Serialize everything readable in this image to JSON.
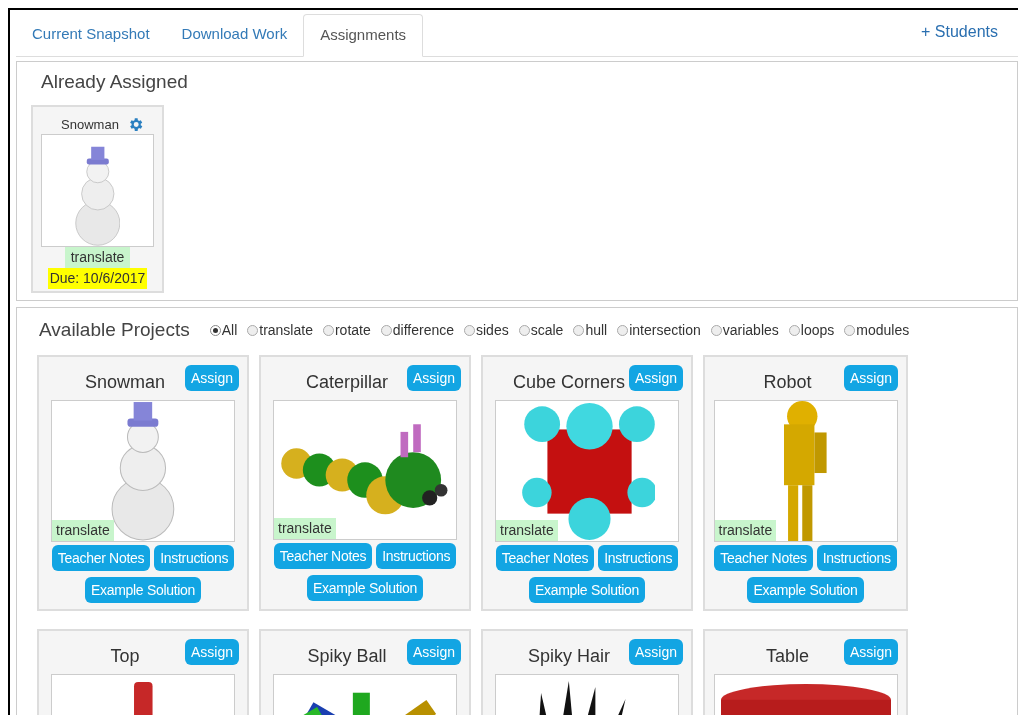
{
  "tabs": [
    {
      "label": "Current Snapshot",
      "selected": false
    },
    {
      "label": "Download Work",
      "selected": false
    },
    {
      "label": "Assignments",
      "selected": true
    }
  ],
  "students_link": "+ Students",
  "assigned": {
    "heading": "Already Assigned",
    "items": [
      {
        "title": "Snowman",
        "kind": "snowman",
        "tag": "translate",
        "due": "Due: 10/6/2017"
      }
    ]
  },
  "available": {
    "heading": "Available Projects",
    "filters": [
      {
        "label": "All",
        "selected": true
      },
      {
        "label": "translate",
        "selected": false
      },
      {
        "label": "rotate",
        "selected": false
      },
      {
        "label": "difference",
        "selected": false
      },
      {
        "label": "sides",
        "selected": false
      },
      {
        "label": "scale",
        "selected": false
      },
      {
        "label": "hull",
        "selected": false
      },
      {
        "label": "intersection",
        "selected": false
      },
      {
        "label": "variables",
        "selected": false
      },
      {
        "label": "loops",
        "selected": false
      },
      {
        "label": "modules",
        "selected": false
      }
    ],
    "projects": [
      {
        "title": "Snowman",
        "kind": "snowman",
        "assign": "Assign",
        "tag": "translate",
        "buttons": [
          "Teacher Notes",
          "Instructions",
          "Example Solution"
        ]
      },
      {
        "title": "Caterpillar",
        "kind": "caterpillar",
        "assign": "Assign",
        "tag": "translate",
        "buttons": [
          "Teacher Notes",
          "Instructions",
          "Example Solution"
        ]
      },
      {
        "title": "Cube Corners",
        "kind": "cubecorners",
        "assign": "Assign",
        "tag": "translate",
        "buttons": [
          "Teacher Notes",
          "Instructions",
          "Example Solution"
        ]
      },
      {
        "title": "Robot",
        "kind": "robot",
        "assign": "Assign",
        "tag": "translate",
        "buttons": [
          "Teacher Notes",
          "Instructions",
          "Example Solution"
        ]
      },
      {
        "title": "Top",
        "kind": "top",
        "assign": "Assign"
      },
      {
        "title": "Spiky Ball",
        "kind": "spikyball",
        "assign": "Assign"
      },
      {
        "title": "Spiky Hair",
        "kind": "spikyhair",
        "assign": "Assign"
      },
      {
        "title": "Table",
        "kind": "table",
        "assign": "Assign"
      }
    ]
  }
}
